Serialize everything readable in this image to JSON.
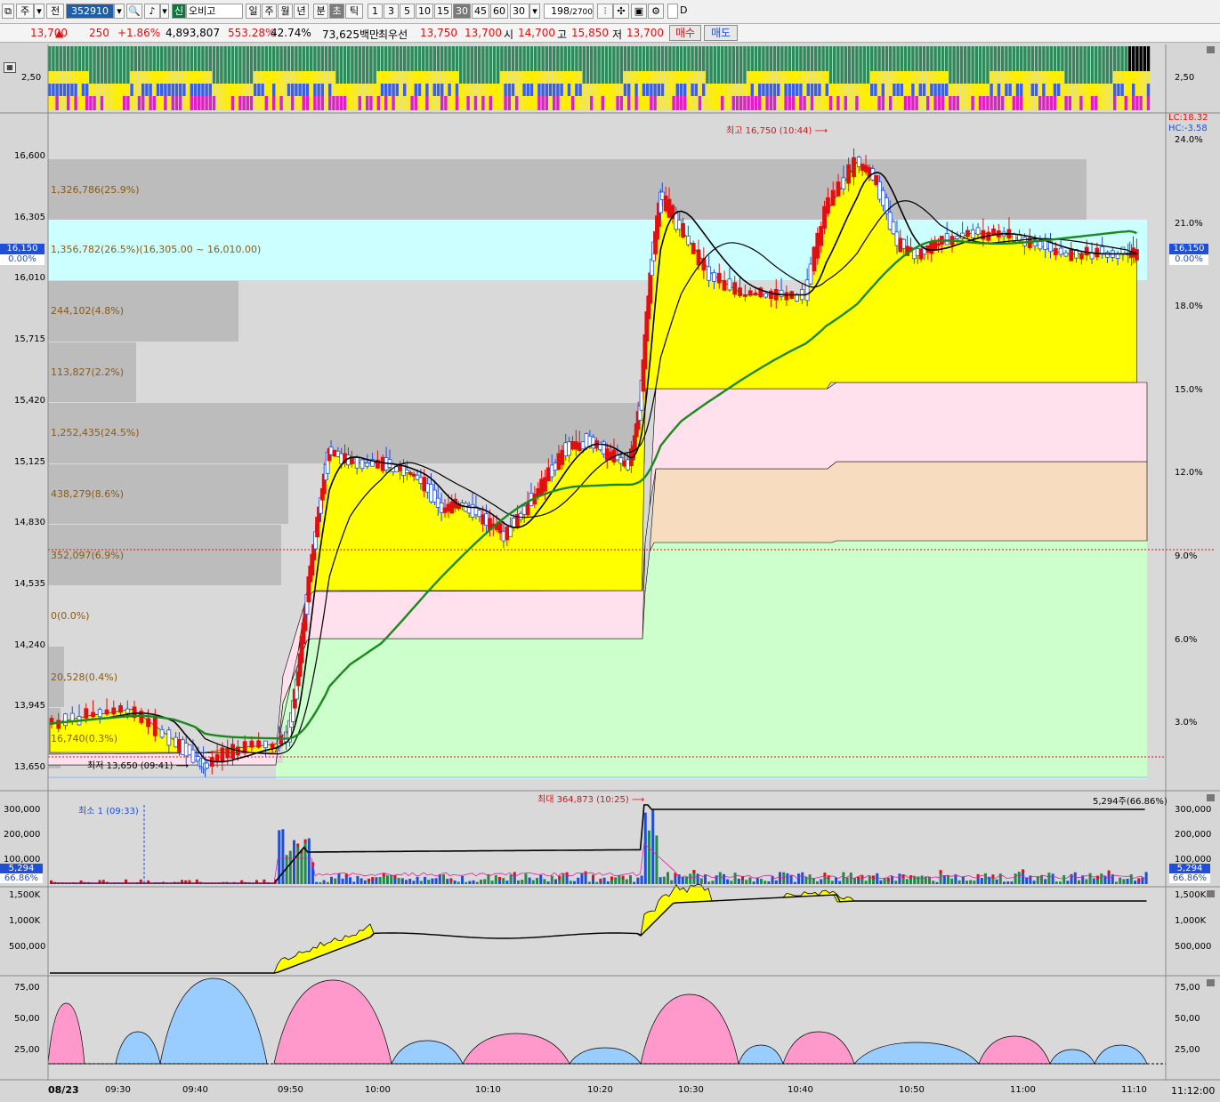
{
  "toolbar": {
    "market": "주",
    "range": "전",
    "code": "352910",
    "new_badge": "신",
    "name": "오비고",
    "periods": [
      "일",
      "주",
      "월",
      "년",
      "분",
      "초",
      "틱"
    ],
    "intervals": [
      "1",
      "3",
      "5",
      "10",
      "15",
      "30",
      "45",
      "60"
    ],
    "active_interval": "30",
    "count_select": "30",
    "bars": "198",
    "bars_total": "/2700",
    "checkbox_label": "D"
  },
  "quote": {
    "price": "13,700",
    "change": "250",
    "change_pct": "+1.86%",
    "volume": "4,893,807",
    "vol_ratio": "553.28%",
    "turnover_ratio": "42.74%",
    "amount": "73,625백만",
    "best_label": "최우선",
    "best_ask": "13,750",
    "best_bid": "13,700",
    "open_label": "시",
    "open": "14,700",
    "high_label": "고",
    "high": "15,850",
    "low_label": "저",
    "low": "13,700",
    "buy_label": "매수",
    "sell_label": "매도"
  },
  "colors": {
    "up": "#e01010",
    "down": "#1f4fd8",
    "fill_yellow": "#ffff00",
    "band_pink": "#ffe0ec",
    "band_peach": "#f8dcc0",
    "band_green": "#ccffcc",
    "zone_cyan": "#ccffff",
    "ma_green": "#1a8a1a"
  },
  "strip_panel": {
    "axis_label": "2,50"
  },
  "price_panel": {
    "y_ticks": [
      "16,600",
      "16,305",
      "16,010",
      "15,715",
      "15,420",
      "15,125",
      "14,830",
      "14,535",
      "14,240",
      "13,945",
      "13,650"
    ],
    "right_ticks": [
      "24.0%",
      "21.0%",
      "18.0%",
      "15.0%",
      "12.0%",
      "9.0%",
      "6.0%",
      "3.0%"
    ],
    "current_price": "16,150",
    "current_pct": "0.00%",
    "lc_label": "LC:18.32",
    "hc_label": "HC:-3.58",
    "high_note": "최고 16,750 (10:44)",
    "low_note": "최저 13,650 (09:41)",
    "volume_profile": [
      "1,326,786(25.9%)",
      "1,356,782(26.5%)(16,305.00 ~ 16,010.00)",
      "244,102(4.8%)",
      "113,827(2.2%)",
      "1,252,435(24.5%)",
      "438,279(8.6%)",
      "352,097(6.9%)",
      "0(0.0%)",
      "20,528(0.4%)",
      "16,740(0.3%)"
    ]
  },
  "volume_panel": {
    "y_ticks": [
      "300,000",
      "200,000",
      "100,000"
    ],
    "current": "5,294",
    "current_pct": "66.86%",
    "max_note": "최대 364,873 (10:25)",
    "min_note": "최소 1 (09:33)",
    "last_note": "5,294주(66.86%)"
  },
  "obv_panel": {
    "y_ticks": [
      "1,500K",
      "1,000K",
      "500,000"
    ]
  },
  "osc_panel": {
    "y_ticks": [
      "75,00",
      "50,00",
      "25,00"
    ]
  },
  "time_axis": {
    "date": "08/23",
    "labels": [
      "09:30",
      "09:40",
      "09:50",
      "10:00",
      "10:10",
      "10:20",
      "10:30",
      "10:40",
      "10:50",
      "11:00",
      "11:10"
    ],
    "last_time": "11:12:00"
  },
  "chart_data": {
    "type": "candlestick",
    "x": "time (08/23, 30-second bars)",
    "y_range": [
      13650,
      16750
    ],
    "series": [
      {
        "name": "price close (approx)",
        "points": [
          [
            "09:26",
            13860
          ],
          [
            "09:30",
            13900
          ],
          [
            "09:34",
            13930
          ],
          [
            "09:38",
            13780
          ],
          [
            "09:40",
            13700
          ],
          [
            "09:41",
            13650
          ],
          [
            "09:44",
            13740
          ],
          [
            "09:48",
            13760
          ],
          [
            "09:49",
            13800
          ],
          [
            "09:50",
            14100
          ],
          [
            "09:51",
            14560
          ],
          [
            "09:52",
            14900
          ],
          [
            "09:53",
            15200
          ],
          [
            "09:55",
            15130
          ],
          [
            "09:58",
            15130
          ],
          [
            "10:00",
            15100
          ],
          [
            "10:02",
            15050
          ],
          [
            "10:04",
            14900
          ],
          [
            "10:06",
            14930
          ],
          [
            "10:08",
            14860
          ],
          [
            "10:10",
            14780
          ],
          [
            "10:12",
            14900
          ],
          [
            "10:14",
            15050
          ],
          [
            "10:16",
            15200
          ],
          [
            "10:18",
            15240
          ],
          [
            "10:20",
            15180
          ],
          [
            "10:22",
            15120
          ],
          [
            "10:23",
            15400
          ],
          [
            "10:24",
            16050
          ],
          [
            "10:25",
            16450
          ],
          [
            "10:27",
            16270
          ],
          [
            "10:30",
            16050
          ],
          [
            "10:33",
            15950
          ],
          [
            "10:36",
            15950
          ],
          [
            "10:39",
            15950
          ],
          [
            "10:41",
            16350
          ],
          [
            "10:44",
            16600
          ],
          [
            "10:46",
            16500
          ],
          [
            "10:48",
            16200
          ],
          [
            "10:50",
            16150
          ],
          [
            "10:52",
            16200
          ],
          [
            "10:55",
            16250
          ],
          [
            "10:58",
            16250
          ],
          [
            "11:01",
            16200
          ],
          [
            "11:04",
            16150
          ],
          [
            "11:07",
            16150
          ],
          [
            "11:10",
            16150
          ],
          [
            "11:11",
            16150
          ]
        ]
      }
    ]
  }
}
